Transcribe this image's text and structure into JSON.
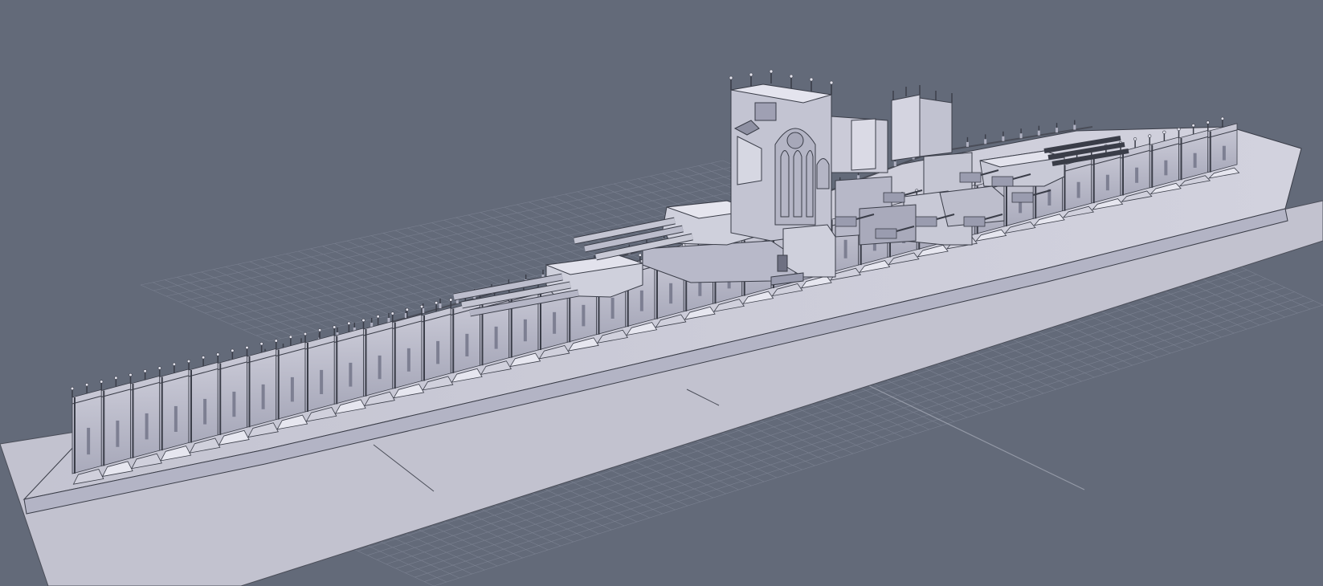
{
  "app": {
    "view": "3d-modeling-viewport",
    "background_color": "#636a79",
    "grid_color": "#8a90a0",
    "model_face_light": "#d9d9e6",
    "model_face_mid": "#b8b8c8",
    "model_face_dark": "#8e90a2",
    "edge_color": "#3a3d48"
  },
  "model": {
    "icon": "gothic-battleship-model"
  }
}
